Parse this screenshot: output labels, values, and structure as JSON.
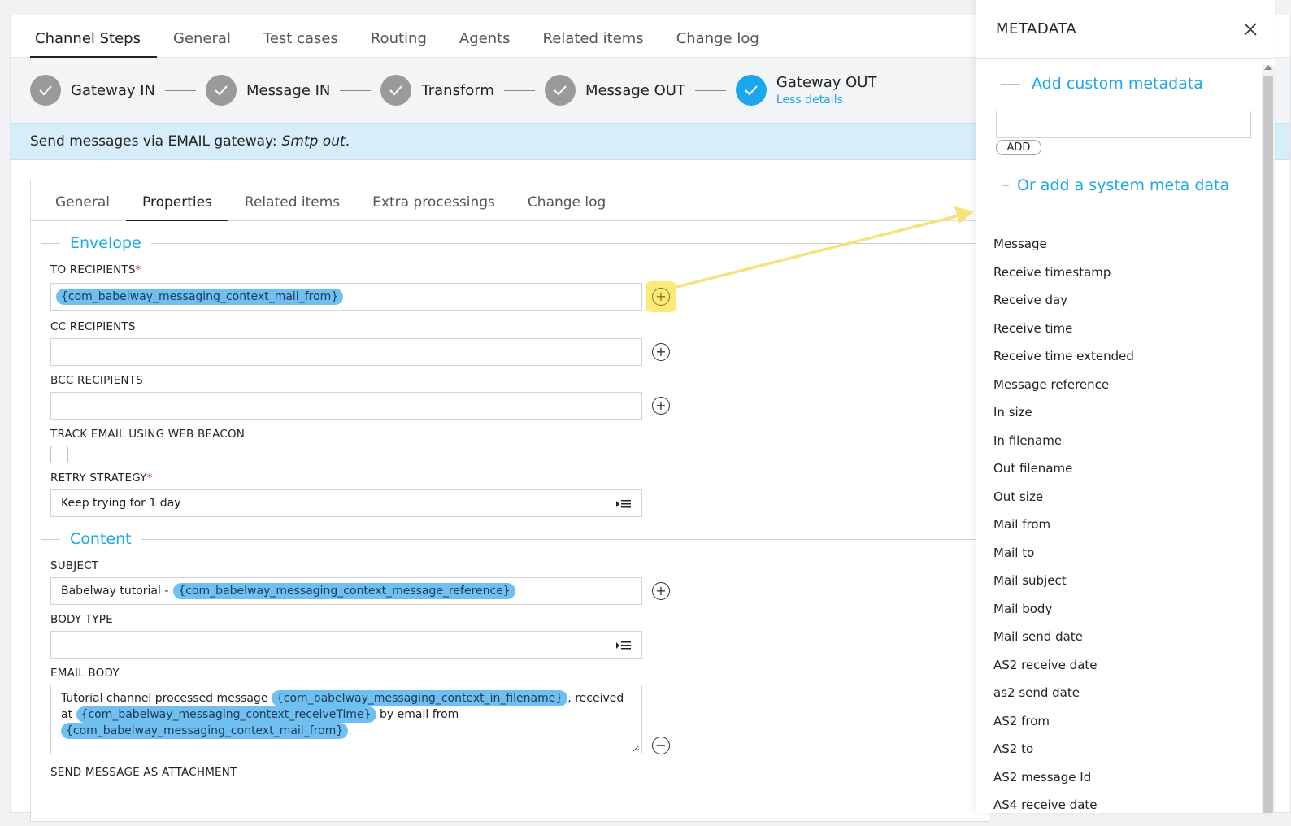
{
  "top_tabs": [
    "Channel Steps",
    "General",
    "Test cases",
    "Routing",
    "Agents",
    "Related items",
    "Change log"
  ],
  "steps": [
    "Gateway IN",
    "Message IN",
    "Transform",
    "Message OUT",
    "Gateway OUT"
  ],
  "less_details": "Less details",
  "banner": {
    "text": "Send messages via EMAIL gateway:",
    "gateway": "Smtp out",
    "suffix": "."
  },
  "inner_tabs": [
    "General",
    "Properties",
    "Related items",
    "Extra processings",
    "Change log"
  ],
  "envelope": {
    "title": "Envelope",
    "to_label": "TO RECIPIENTS",
    "to_value": "{com_babelway_messaging_context_mail_from}",
    "cc_label": "CC RECIPIENTS",
    "bcc_label": "BCC RECIPIENTS",
    "track_label": "TRACK EMAIL USING WEB BEACON",
    "retry_label": "RETRY STRATEGY",
    "retry_value": "Keep trying for 1 day"
  },
  "content": {
    "title": "Content",
    "subject_label": "SUBJECT",
    "subject_text": "Babelway tutorial -",
    "subject_chip": "{com_babelway_messaging_context_message_reference}",
    "body_type_label": "BODY TYPE",
    "email_body_label": "EMAIL BODY",
    "body_text1": "Tutorial channel processed message",
    "body_chip1": "{com_babelway_messaging_context_in_filename}",
    "body_text2": ", received at",
    "body_chip2": "{com_babelway_messaging_context_receiveTime}",
    "body_text3": "by email from",
    "body_chip3": "{com_babelway_messaging_context_mail_from}",
    "body_text4": ".",
    "attachment_label": "SEND MESSAGE AS ATTACHMENT"
  },
  "metadata": {
    "title": "METADATA",
    "custom_title": "Add custom metadata",
    "add_label": "ADD",
    "system_title": "Or add a system meta data",
    "items": [
      "Message",
      "Receive timestamp",
      "Receive day",
      "Receive time",
      "Receive time extended",
      "Message reference",
      "In size",
      "In filename",
      "Out filename",
      "Out size",
      "Mail from",
      "Mail to",
      "Mail subject",
      "Mail body",
      "Mail send date",
      "AS2 receive date",
      "as2 send date",
      "AS2 from",
      "AS2 to",
      "AS2 message Id",
      "AS4 receive date"
    ]
  },
  "colors": {
    "accent": "#1aa7ec",
    "chip": "#6fc0f0",
    "highlight": "#fbe97a",
    "banner": "#d7eefa"
  }
}
